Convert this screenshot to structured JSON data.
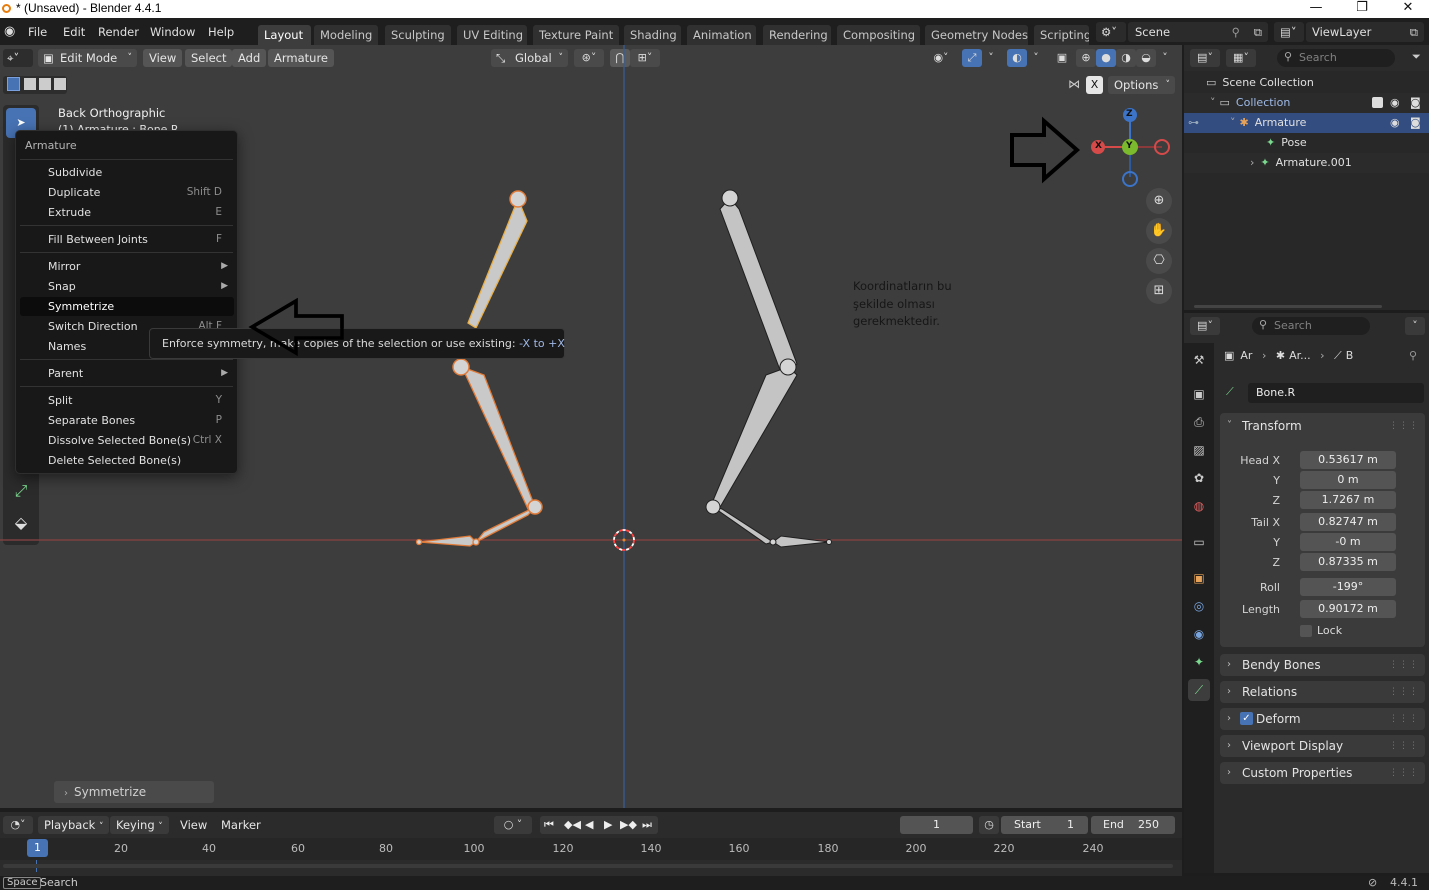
{
  "window": {
    "title": "* (Unsaved) - Blender 4.4.1",
    "controls": [
      "—",
      "❐",
      "✕"
    ]
  },
  "topbar": {
    "menus": [
      "File",
      "Edit",
      "Render",
      "Window",
      "Help"
    ],
    "workspaces": [
      "Layout",
      "Modeling",
      "Sculpting",
      "UV Editing",
      "Texture Paint",
      "Shading",
      "Animation",
      "Rendering",
      "Compositing",
      "Geometry Nodes",
      "Scripting"
    ],
    "active_workspace": "Layout",
    "scene": "Scene",
    "view_layer": "ViewLayer"
  },
  "viewport_header": {
    "mode": "Edit Mode",
    "menus": [
      "View",
      "Select",
      "Add",
      "Armature"
    ],
    "transform_orientation": "Global",
    "options_label": "Options",
    "x_toggle": "X"
  },
  "viewport": {
    "view_name": "Back Orthographic",
    "object_line": "(1) Armature : Bone.R",
    "annotation_text": [
      "Koordinatların bu",
      "şekilde olması",
      "gerekmektedir."
    ],
    "gizmo_axes": {
      "z": "Z",
      "y": "Y",
      "x": "X"
    },
    "last_operator": "Symmetrize"
  },
  "context_menu": {
    "title": "Armature",
    "items": [
      {
        "label": "Subdivide",
        "shortcut": ""
      },
      {
        "label": "Duplicate",
        "shortcut": "Shift D"
      },
      {
        "label": "Extrude",
        "shortcut": "E"
      },
      {
        "label": "Fill Between Joints",
        "shortcut": "F"
      },
      {
        "label": "Mirror",
        "shortcut": ""
      },
      {
        "label": "Snap",
        "shortcut": ""
      },
      {
        "label": "Symmetrize",
        "shortcut": ""
      },
      {
        "label": "Switch Direction",
        "shortcut": "Alt F"
      },
      {
        "label": "Names",
        "shortcut": ""
      },
      {
        "label": "Parent",
        "shortcut": ""
      },
      {
        "label": "Split",
        "shortcut": "Y"
      },
      {
        "label": "Separate Bones",
        "shortcut": "P"
      },
      {
        "label": "Dissolve Selected Bone(s)",
        "shortcut": "Ctrl X"
      },
      {
        "label": "Delete Selected Bone(s)",
        "shortcut": ""
      }
    ],
    "tooltip_text": "Enforce symmetry, make copies of the selection or use existing: ",
    "tooltip_highlight": "-X to +X"
  },
  "outliner": {
    "search_placeholder": "Search",
    "rows": [
      "Scene Collection",
      "Collection",
      "Armature",
      "Pose",
      "Armature.001"
    ]
  },
  "properties": {
    "search_placeholder": "Search",
    "breadcrumb": [
      "Ar",
      "Ar...",
      "B"
    ],
    "bone_name": "Bone.R",
    "transform_title": "Transform",
    "head_label": "Head X",
    "head": [
      "0.53617 m",
      "0 m",
      "1.7267 m"
    ],
    "tail_label": "Tail X",
    "tail": [
      "0.82747 m",
      "-0 m",
      "0.87335 m"
    ],
    "axis_labels": [
      "Y",
      "Z"
    ],
    "roll_label": "Roll",
    "roll": "-199°",
    "length_label": "Length",
    "length": "0.90172 m",
    "lock_label": "Lock",
    "sections": [
      "Bendy Bones",
      "Relations",
      "Deform",
      "Viewport Display",
      "Custom Properties"
    ]
  },
  "timeline": {
    "menus": [
      "Playback",
      "Keying",
      "View",
      "Marker"
    ],
    "current_frame": "1",
    "start_label": "Start",
    "start": "1",
    "end_label": "End",
    "end": "250",
    "ruler": [
      "20",
      "40",
      "60",
      "80",
      "100",
      "120",
      "140",
      "160",
      "180",
      "200",
      "220",
      "240"
    ],
    "playhead": "1"
  },
  "statusbar": {
    "key": "Space",
    "action": "Search",
    "version": "4.4.1"
  }
}
